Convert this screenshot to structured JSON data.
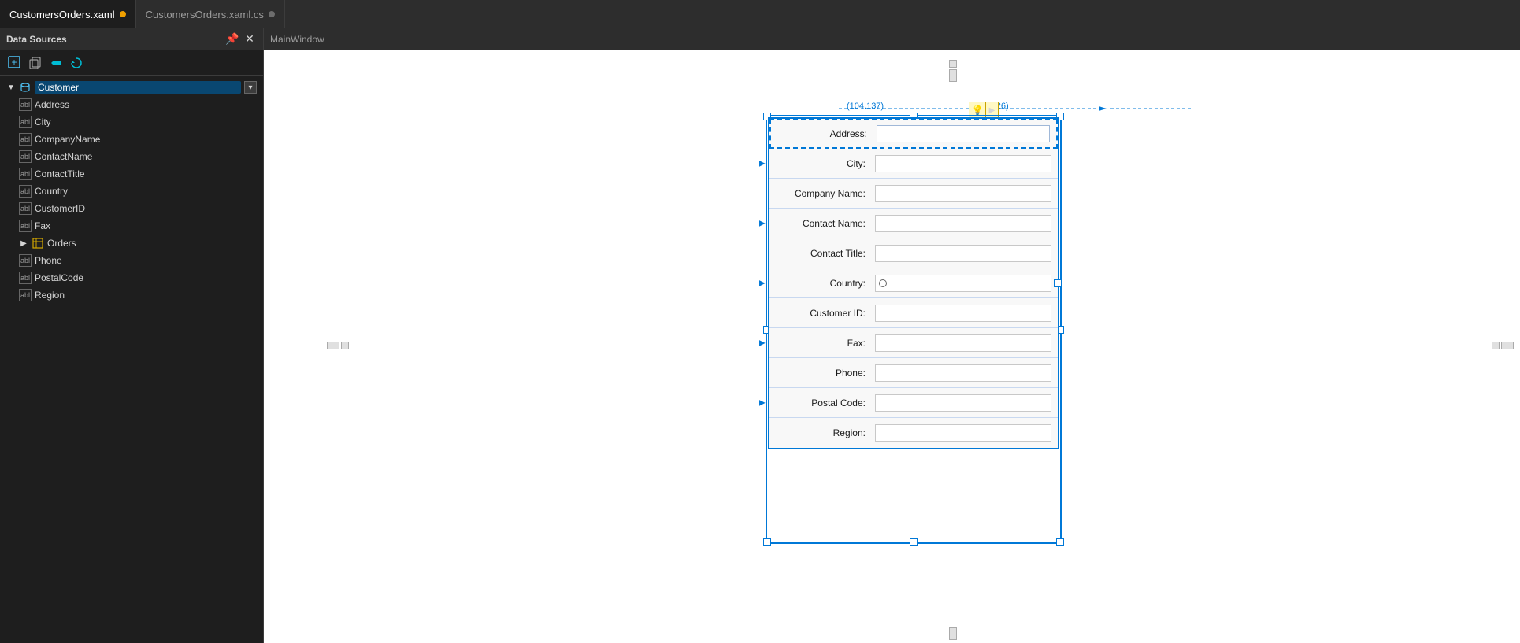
{
  "tabbar": {
    "tabs": [
      {
        "id": "xaml",
        "label": "CustomersOrders.xaml",
        "dot": "orange",
        "active": true
      },
      {
        "id": "cs",
        "label": "CustomersOrders.xaml.cs",
        "dot": "gray",
        "active": false
      }
    ]
  },
  "datasources": {
    "panel_title": "Data Sources",
    "toolbar": {
      "add": "+",
      "copy": "⧉",
      "undo": "↩",
      "refresh": "↻"
    },
    "tree": {
      "root": {
        "label": "Customer",
        "expanded": true,
        "children": [
          {
            "id": "address",
            "label": "Address",
            "type": "field"
          },
          {
            "id": "city",
            "label": "City",
            "type": "field",
            "highlighted": true
          },
          {
            "id": "companyname",
            "label": "CompanyName",
            "type": "field"
          },
          {
            "id": "contactname",
            "label": "ContactName",
            "type": "field"
          },
          {
            "id": "contacttitle",
            "label": "ContactTitle",
            "type": "field"
          },
          {
            "id": "country",
            "label": "Country",
            "type": "field",
            "highlighted": true
          },
          {
            "id": "customerid",
            "label": "CustomerID",
            "type": "field"
          },
          {
            "id": "fax",
            "label": "Fax",
            "type": "field"
          },
          {
            "id": "orders",
            "label": "Orders",
            "type": "table",
            "expandable": true
          },
          {
            "id": "phone",
            "label": "Phone",
            "type": "field"
          },
          {
            "id": "postalcode",
            "label": "PostalCode",
            "type": "field"
          },
          {
            "id": "region",
            "label": "Region",
            "type": "field"
          }
        ]
      }
    }
  },
  "designer": {
    "window_title": "MainWindow",
    "tab_label": "CustomersOrders.xaml",
    "dim1": "(104.137)",
    "dim2": "(126)",
    "form_fields": [
      {
        "id": "address",
        "label": "Address:",
        "type": "text",
        "nav": false
      },
      {
        "id": "city",
        "label": "City:",
        "type": "text",
        "nav": true,
        "selected": true
      },
      {
        "id": "companyname",
        "label": "Company Name:",
        "type": "text",
        "nav": false
      },
      {
        "id": "contactname",
        "label": "Contact Name:",
        "type": "text",
        "nav": true
      },
      {
        "id": "contacttitle",
        "label": "Contact Title:",
        "type": "text",
        "nav": false
      },
      {
        "id": "country",
        "label": "Country:",
        "type": "circle",
        "nav": true
      },
      {
        "id": "customerid",
        "label": "Customer ID:",
        "type": "text",
        "nav": false
      },
      {
        "id": "fax",
        "label": "Fax:",
        "type": "text",
        "nav": true
      },
      {
        "id": "phone",
        "label": "Phone:",
        "type": "text",
        "nav": false
      },
      {
        "id": "postalcode",
        "label": "Postal Code:",
        "type": "text",
        "nav": true
      },
      {
        "id": "region",
        "label": "Region:",
        "type": "text",
        "nav": false
      }
    ]
  },
  "icons": {
    "pin": "📌",
    "close": "✕",
    "expand": "▶",
    "collapse": "▼",
    "dropdown": "▾",
    "arrow_right": "▶",
    "bulb": "💡"
  }
}
